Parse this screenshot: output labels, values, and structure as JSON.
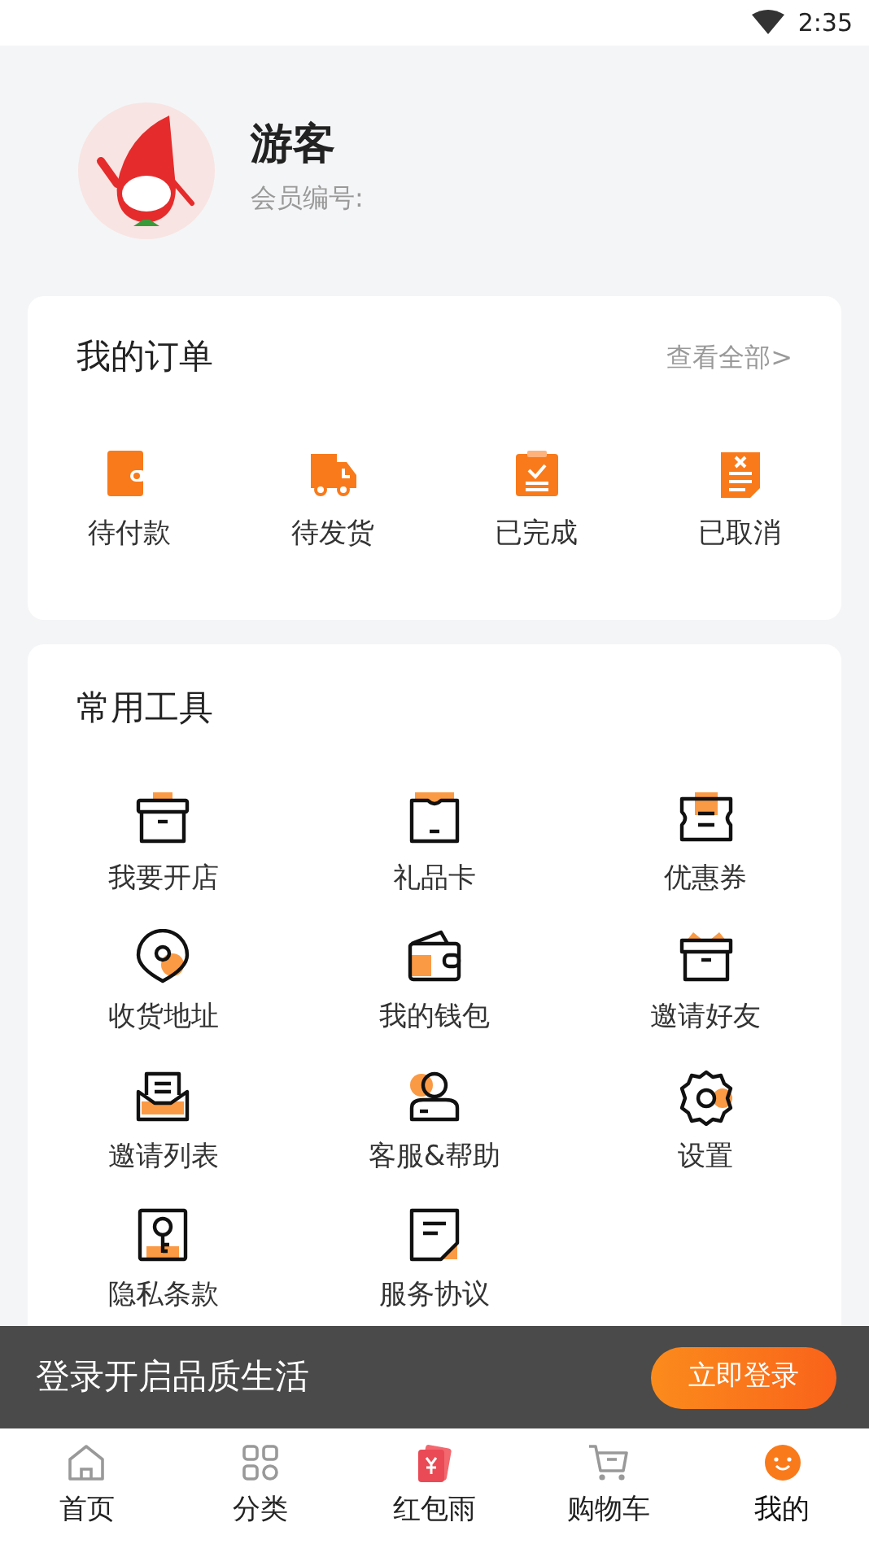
{
  "status_bar": {
    "time": "2:35"
  },
  "profile": {
    "name": "游客",
    "member_label": "会员编号:"
  },
  "orders": {
    "title": "我的订单",
    "view_all": "查看全部>",
    "items": [
      {
        "label": "待付款"
      },
      {
        "label": "待发货"
      },
      {
        "label": "已完成"
      },
      {
        "label": "已取消"
      }
    ]
  },
  "tools": {
    "title": "常用工具",
    "items": [
      {
        "label": "我要开店"
      },
      {
        "label": "礼品卡"
      },
      {
        "label": "优惠券"
      },
      {
        "label": "收货地址"
      },
      {
        "label": "我的钱包"
      },
      {
        "label": "邀请好友"
      },
      {
        "label": "邀请列表"
      },
      {
        "label": "客服&帮助"
      },
      {
        "label": "设置"
      },
      {
        "label": "隐私条款"
      },
      {
        "label": "服务协议"
      }
    ]
  },
  "login_banner": {
    "text": "登录开启品质生活",
    "button": "立即登录"
  },
  "bottom_nav": [
    {
      "label": "首页",
      "selected": false
    },
    {
      "label": "分类",
      "selected": false
    },
    {
      "label": "红包雨",
      "selected": false
    },
    {
      "label": "购物车",
      "selected": false
    },
    {
      "label": "我的",
      "selected": true
    }
  ]
}
